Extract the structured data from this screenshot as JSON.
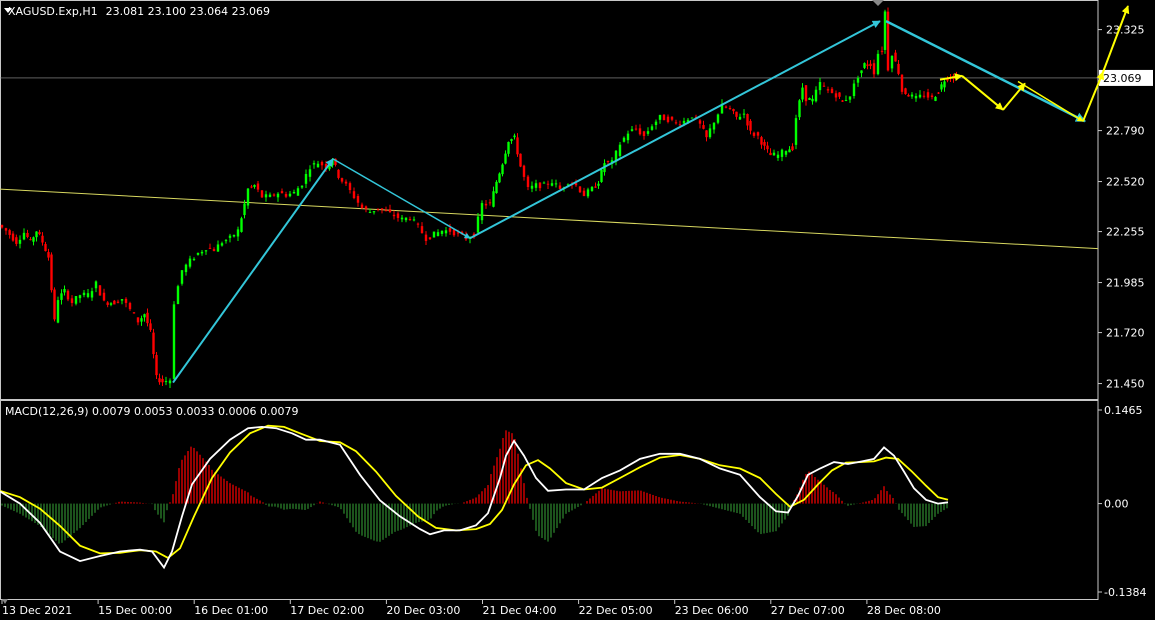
{
  "header": {
    "symbol": "XAGUSD.Exp,H1",
    "ohlc": "23.081 23.100 23.064 23.069"
  },
  "macd_header": {
    "title": "MACD(12,26,9) 0.0079 0.0053 0.0033 0.0006 0.0079"
  },
  "colors": {
    "background": "#000000",
    "bull": "#00ff00",
    "bear": "#ff0000",
    "cyan_arrow": "#33c6d9",
    "yellow_arrow": "#ffff00",
    "trendline": "#d8d860",
    "macd_line": "#ffffff",
    "signal_line": "#ffff00"
  },
  "chart_data": [
    {
      "type": "candlestick",
      "ylim": [
        21.4,
        23.45
      ],
      "price_ticks": [
        "23.325",
        "23.069",
        "22.790",
        "22.520",
        "22.255",
        "21.985",
        "21.720",
        "21.450"
      ],
      "current_price": "23.069",
      "x_labels": [
        "13 Dec 2021",
        "15 Dec 00:00",
        "16 Dec 01:00",
        "17 Dec 02:00",
        "20 Dec 03:00",
        "21 Dec 04:00",
        "22 Dec 05:00",
        "23 Dec 06:00",
        "27 Dec 07:00",
        "28 Dec 08:00"
      ],
      "close_path": [
        [
          0,
          22.29
        ],
        [
          8,
          22.26
        ],
        [
          18,
          22.2
        ],
        [
          26,
          22.25
        ],
        [
          32,
          22.2
        ],
        [
          38,
          22.26
        ],
        [
          44,
          22.2
        ],
        [
          50,
          22.12
        ],
        [
          56,
          21.78
        ],
        [
          60,
          21.9
        ],
        [
          66,
          21.94
        ],
        [
          74,
          21.88
        ],
        [
          82,
          21.92
        ],
        [
          90,
          21.92
        ],
        [
          98,
          21.98
        ],
        [
          106,
          21.88
        ],
        [
          116,
          21.88
        ],
        [
          124,
          21.9
        ],
        [
          132,
          21.84
        ],
        [
          140,
          21.78
        ],
        [
          146,
          21.82
        ],
        [
          152,
          21.72
        ],
        [
          158,
          21.48
        ],
        [
          164,
          21.46
        ],
        [
          172,
          21.47
        ],
        [
          176,
          21.88
        ],
        [
          184,
          22.05
        ],
        [
          192,
          22.1
        ],
        [
          200,
          22.14
        ],
        [
          208,
          22.17
        ],
        [
          216,
          22.16
        ],
        [
          224,
          22.2
        ],
        [
          232,
          22.22
        ],
        [
          240,
          22.26
        ],
        [
          246,
          22.4
        ],
        [
          250,
          22.48
        ],
        [
          256,
          22.5
        ],
        [
          264,
          22.44
        ],
        [
          272,
          22.44
        ],
        [
          280,
          22.46
        ],
        [
          288,
          22.45
        ],
        [
          296,
          22.46
        ],
        [
          304,
          22.51
        ],
        [
          312,
          22.6
        ],
        [
          320,
          22.62
        ],
        [
          328,
          22.6
        ],
        [
          334,
          22.64
        ],
        [
          340,
          22.55
        ],
        [
          348,
          22.5
        ],
        [
          356,
          22.44
        ],
        [
          364,
          22.38
        ],
        [
          372,
          22.36
        ],
        [
          380,
          22.38
        ],
        [
          388,
          22.36
        ],
        [
          396,
          22.34
        ],
        [
          404,
          22.32
        ],
        [
          412,
          22.33
        ],
        [
          420,
          22.28
        ],
        [
          428,
          22.22
        ],
        [
          436,
          22.24
        ],
        [
          444,
          22.26
        ],
        [
          452,
          22.26
        ],
        [
          460,
          22.24
        ],
        [
          468,
          22.22
        ],
        [
          476,
          22.24
        ],
        [
          484,
          22.4
        ],
        [
          492,
          22.4
        ],
        [
          498,
          22.52
        ],
        [
          504,
          22.62
        ],
        [
          510,
          22.74
        ],
        [
          516,
          22.75
        ],
        [
          522,
          22.6
        ],
        [
          530,
          22.48
        ],
        [
          538,
          22.5
        ],
        [
          546,
          22.5
        ],
        [
          554,
          22.52
        ],
        [
          562,
          22.48
        ],
        [
          570,
          22.52
        ],
        [
          578,
          22.5
        ],
        [
          586,
          22.45
        ],
        [
          594,
          22.48
        ],
        [
          600,
          22.52
        ],
        [
          606,
          22.62
        ],
        [
          614,
          22.62
        ],
        [
          622,
          22.72
        ],
        [
          630,
          22.78
        ],
        [
          638,
          22.8
        ],
        [
          646,
          22.76
        ],
        [
          654,
          22.82
        ],
        [
          662,
          22.86
        ],
        [
          670,
          22.85
        ],
        [
          678,
          22.83
        ],
        [
          686,
          22.84
        ],
        [
          694,
          22.87
        ],
        [
          702,
          22.82
        ],
        [
          708,
          22.75
        ],
        [
          716,
          22.84
        ],
        [
          724,
          22.92
        ],
        [
          732,
          22.9
        ],
        [
          738,
          22.86
        ],
        [
          746,
          22.88
        ],
        [
          752,
          22.78
        ],
        [
          760,
          22.76
        ],
        [
          766,
          22.7
        ],
        [
          772,
          22.66
        ],
        [
          780,
          22.66
        ],
        [
          788,
          22.69
        ],
        [
          794,
          22.7
        ],
        [
          798,
          22.86
        ],
        [
          804,
          23.02
        ],
        [
          808,
          22.96
        ],
        [
          814,
          22.95
        ],
        [
          822,
          23.04
        ],
        [
          830,
          23.0
        ],
        [
          838,
          22.98
        ],
        [
          844,
          22.94
        ],
        [
          852,
          22.98
        ],
        [
          860,
          23.08
        ],
        [
          866,
          23.14
        ],
        [
          872,
          23.14
        ],
        [
          876,
          23.1
        ],
        [
          880,
          23.2
        ],
        [
          884,
          23.22
        ],
        [
          886,
          23.42
        ],
        [
          890,
          23.12
        ],
        [
          894,
          23.2
        ],
        [
          900,
          23.1
        ],
        [
          904,
          23.0
        ],
        [
          910,
          22.98
        ],
        [
          918,
          22.96
        ],
        [
          926,
          22.98
        ],
        [
          934,
          22.96
        ],
        [
          940,
          23.0
        ],
        [
          946,
          23.06
        ],
        [
          952,
          23.08
        ],
        [
          958,
          23.07
        ]
      ]
    },
    {
      "type": "macd",
      "ylim": [
        -0.1384,
        0.1465
      ],
      "y_ticks": [
        "0.1465",
        "0.00",
        "-0.1384"
      ],
      "macd_points": [
        [
          0,
          0.019
        ],
        [
          20,
          0.0
        ],
        [
          40,
          -0.03
        ],
        [
          60,
          -0.075
        ],
        [
          80,
          -0.09
        ],
        [
          100,
          -0.082
        ],
        [
          120,
          -0.075
        ],
        [
          140,
          -0.072
        ],
        [
          152,
          -0.075
        ],
        [
          164,
          -0.1
        ],
        [
          172,
          -0.075
        ],
        [
          182,
          -0.02
        ],
        [
          192,
          0.03
        ],
        [
          210,
          0.07
        ],
        [
          230,
          0.1
        ],
        [
          248,
          0.118
        ],
        [
          262,
          0.12
        ],
        [
          276,
          0.118
        ],
        [
          292,
          0.11
        ],
        [
          306,
          0.1
        ],
        [
          320,
          0.1
        ],
        [
          340,
          0.092
        ],
        [
          360,
          0.045
        ],
        [
          380,
          0.005
        ],
        [
          400,
          -0.02
        ],
        [
          420,
          -0.04
        ],
        [
          430,
          -0.048
        ],
        [
          444,
          -0.042
        ],
        [
          460,
          -0.042
        ],
        [
          476,
          -0.034
        ],
        [
          488,
          -0.015
        ],
        [
          500,
          0.04
        ],
        [
          506,
          0.075
        ],
        [
          514,
          0.098
        ],
        [
          524,
          0.075
        ],
        [
          536,
          0.04
        ],
        [
          548,
          0.02
        ],
        [
          566,
          0.022
        ],
        [
          584,
          0.022
        ],
        [
          602,
          0.04
        ],
        [
          620,
          0.052
        ],
        [
          640,
          0.07
        ],
        [
          660,
          0.078
        ],
        [
          680,
          0.078
        ],
        [
          700,
          0.07
        ],
        [
          720,
          0.055
        ],
        [
          740,
          0.045
        ],
        [
          760,
          0.01
        ],
        [
          776,
          -0.012
        ],
        [
          788,
          -0.014
        ],
        [
          798,
          0.012
        ],
        [
          808,
          0.045
        ],
        [
          820,
          0.055
        ],
        [
          834,
          0.065
        ],
        [
          848,
          0.062
        ],
        [
          862,
          0.066
        ],
        [
          874,
          0.07
        ],
        [
          884,
          0.088
        ],
        [
          894,
          0.075
        ],
        [
          904,
          0.05
        ],
        [
          914,
          0.024
        ],
        [
          926,
          0.006
        ],
        [
          938,
          0.0
        ],
        [
          948,
          0.002
        ]
      ],
      "signal_points": [
        [
          0,
          0.02
        ],
        [
          20,
          0.01
        ],
        [
          40,
          -0.008
        ],
        [
          60,
          -0.035
        ],
        [
          80,
          -0.066
        ],
        [
          100,
          -0.078
        ],
        [
          120,
          -0.077
        ],
        [
          140,
          -0.073
        ],
        [
          156,
          -0.075
        ],
        [
          168,
          -0.085
        ],
        [
          180,
          -0.07
        ],
        [
          194,
          -0.02
        ],
        [
          212,
          0.04
        ],
        [
          230,
          0.08
        ],
        [
          250,
          0.11
        ],
        [
          268,
          0.122
        ],
        [
          284,
          0.12
        ],
        [
          300,
          0.11
        ],
        [
          320,
          0.098
        ],
        [
          340,
          0.096
        ],
        [
          356,
          0.082
        ],
        [
          376,
          0.05
        ],
        [
          396,
          0.012
        ],
        [
          418,
          -0.02
        ],
        [
          436,
          -0.038
        ],
        [
          456,
          -0.042
        ],
        [
          476,
          -0.04
        ],
        [
          490,
          -0.032
        ],
        [
          502,
          -0.01
        ],
        [
          514,
          0.03
        ],
        [
          526,
          0.06
        ],
        [
          538,
          0.068
        ],
        [
          550,
          0.055
        ],
        [
          566,
          0.032
        ],
        [
          584,
          0.022
        ],
        [
          602,
          0.025
        ],
        [
          620,
          0.04
        ],
        [
          640,
          0.057
        ],
        [
          660,
          0.072
        ],
        [
          680,
          0.076
        ],
        [
          700,
          0.07
        ],
        [
          720,
          0.06
        ],
        [
          740,
          0.055
        ],
        [
          760,
          0.04
        ],
        [
          776,
          0.015
        ],
        [
          790,
          -0.005
        ],
        [
          804,
          0.006
        ],
        [
          818,
          0.03
        ],
        [
          832,
          0.052
        ],
        [
          846,
          0.064
        ],
        [
          860,
          0.065
        ],
        [
          874,
          0.066
        ],
        [
          886,
          0.072
        ],
        [
          898,
          0.07
        ],
        [
          912,
          0.05
        ],
        [
          926,
          0.028
        ],
        [
          938,
          0.01
        ],
        [
          948,
          0.006
        ]
      ]
    }
  ]
}
